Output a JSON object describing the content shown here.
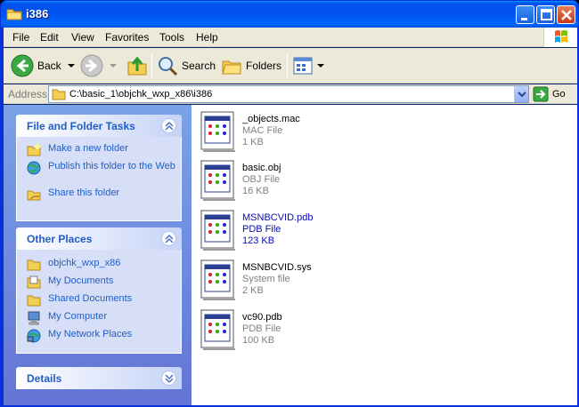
{
  "window": {
    "title": "i386"
  },
  "menu": [
    "File",
    "Edit",
    "View",
    "Favorites",
    "Tools",
    "Help"
  ],
  "toolbar": {
    "back": "Back",
    "search": "Search",
    "folders": "Folders"
  },
  "address": {
    "label": "Address",
    "path": "C:\\basic_1\\objchk_wxp_x86\\i386",
    "go": "Go"
  },
  "tasks_panel": {
    "title": "File and Folder Tasks",
    "items": [
      {
        "label": "Make a new folder",
        "icon": "new-folder-icon"
      },
      {
        "label": "Publish this folder to the Web",
        "icon": "globe-icon"
      },
      {
        "label": "Share this folder",
        "icon": "share-folder-icon"
      }
    ]
  },
  "places_panel": {
    "title": "Other Places",
    "items": [
      {
        "label": "objchk_wxp_x86",
        "icon": "folder-icon"
      },
      {
        "label": "My Documents",
        "icon": "documents-icon"
      },
      {
        "label": "Shared Documents",
        "icon": "folder-icon"
      },
      {
        "label": "My Computer",
        "icon": "computer-icon"
      },
      {
        "label": "My Network Places",
        "icon": "network-icon"
      }
    ]
  },
  "details_panel": {
    "title": "Details"
  },
  "files": [
    {
      "name": "_objects.mac",
      "type": "MAC File",
      "size": "1 KB"
    },
    {
      "name": "basic.obj",
      "type": "OBJ File",
      "size": "16 KB"
    },
    {
      "name": "MSNBCVID.pdb",
      "type": "PDB File",
      "size": "123 KB",
      "selected": true
    },
    {
      "name": "MSNBCVID.sys",
      "type": "System file",
      "size": "2 KB"
    },
    {
      "name": "vc90.pdb",
      "type": "PDB File",
      "size": "100 KB"
    }
  ],
  "colors": {
    "titlebar": "#0053ee",
    "link": "#215dc6",
    "pane": "#6375d6"
  }
}
